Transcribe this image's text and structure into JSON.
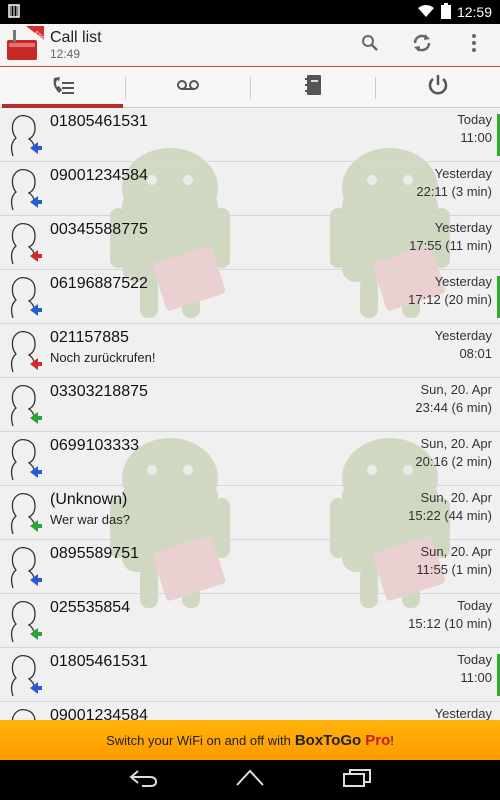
{
  "status_bar": {
    "time": "12:59"
  },
  "app": {
    "title": "Call list",
    "subtitle": "12:49",
    "logo_badge": "FREE"
  },
  "toolbar": {
    "icons": [
      "search-icon",
      "refresh-icon",
      "overflow-menu-icon"
    ]
  },
  "tabs": [
    {
      "icon": "call-list-icon",
      "active": true
    },
    {
      "icon": "voicemail-icon",
      "active": false
    },
    {
      "icon": "phonebook-icon",
      "active": false
    },
    {
      "icon": "power-icon",
      "active": false
    }
  ],
  "calls": [
    {
      "number": "01805461531",
      "note": "",
      "day": "Today",
      "time": "11:00",
      "type": "incoming",
      "new": true
    },
    {
      "number": "09001234584",
      "note": "",
      "day": "Yesterday",
      "time": "22:11 (3 min)",
      "type": "incoming",
      "new": false
    },
    {
      "number": "00345588775",
      "note": "",
      "day": "Yesterday",
      "time": "17:55 (11 min)",
      "type": "missed",
      "new": false
    },
    {
      "number": "06196887522",
      "note": "",
      "day": "Yesterday",
      "time": "17:12 (20 min)",
      "type": "incoming",
      "new": true
    },
    {
      "number": "021157885",
      "note": "Noch zurückrufen!",
      "day": "Yesterday",
      "time": "08:01",
      "type": "missed",
      "new": false
    },
    {
      "number": "03303218875",
      "note": "",
      "day": "Sun, 20. Apr",
      "time": "23:44 (6 min)",
      "type": "outgoing",
      "new": false
    },
    {
      "number": "0699103333",
      "note": "",
      "day": "Sun, 20. Apr",
      "time": "20:16 (2 min)",
      "type": "incoming",
      "new": false
    },
    {
      "number": "(Unknown)",
      "note": "Wer war das?",
      "day": "Sun, 20. Apr",
      "time": "15:22 (44 min)",
      "type": "outgoing",
      "new": false
    },
    {
      "number": "0895589751",
      "note": "",
      "day": "Sun, 20. Apr",
      "time": "11:55 (1 min)",
      "type": "incoming",
      "new": false
    },
    {
      "number": "025535854",
      "note": "",
      "day": "Today",
      "time": "15:12 (10 min)",
      "type": "outgoing",
      "new": false
    },
    {
      "number": "01805461531",
      "note": "",
      "day": "Today",
      "time": "11:00",
      "type": "incoming",
      "new": true
    },
    {
      "number": "09001234584",
      "note": "",
      "day": "Yesterday",
      "time": "",
      "type": "incoming",
      "new": false
    }
  ],
  "call_type_colors": {
    "incoming": "#2a5bd7",
    "missed": "#d22a2a",
    "outgoing": "#2aa33a"
  },
  "promo": {
    "text": "Switch your WiFi on and off with",
    "brand": "BoxToGo",
    "pro": "Pro",
    "suffix": "!"
  },
  "nav": {
    "icons": [
      "back-icon",
      "home-icon",
      "recents-icon"
    ]
  }
}
